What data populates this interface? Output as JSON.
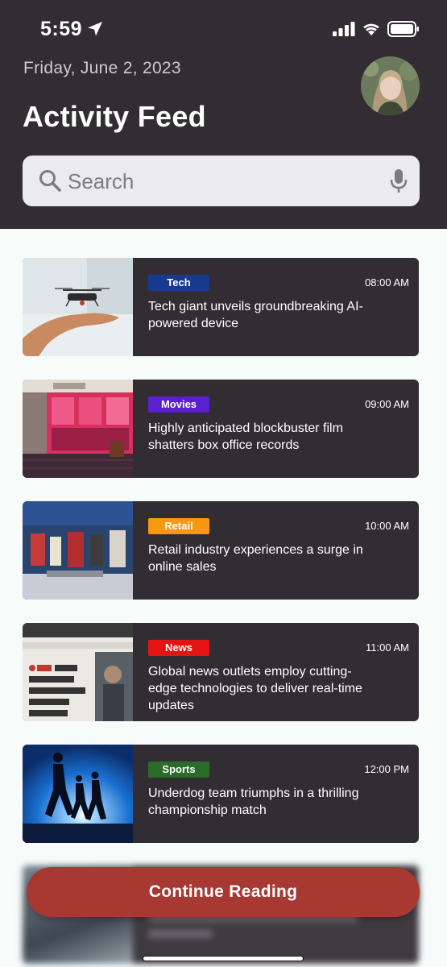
{
  "status_bar": {
    "time": "5:59",
    "icons": [
      "location-arrow-icon",
      "cellular-signal-icon",
      "wifi-icon",
      "battery-icon"
    ]
  },
  "header": {
    "date": "Friday, June 2, 2023",
    "title": "Activity Feed",
    "avatar": "profile-avatar"
  },
  "search": {
    "placeholder": "Search",
    "icon": "search-icon",
    "mic_icon": "microphone-icon"
  },
  "feed": [
    {
      "category": "Tech",
      "badge_color": "#173a8e",
      "time": "08:00 AM",
      "title": "Tech giant unveils groundbreaking AI-powered device",
      "thumb": "drone-hand-image"
    },
    {
      "category": "Movies",
      "badge_color": "#5a1fd0",
      "time": "09:00 AM",
      "title": "Highly anticipated blockbuster film shatters box office records",
      "thumb": "cinema-storefront-image"
    },
    {
      "category": "Retail",
      "badge_color": "#f59a10",
      "time": "10:00 AM",
      "title": "Retail industry experiences a surge in online sales",
      "thumb": "retail-store-image"
    },
    {
      "category": "News",
      "badge_color": "#e21414",
      "time": "11:00 AM",
      "title": "Global news outlets employ cutting-edge technologies to deliver real-time updates",
      "thumb": "news-website-image"
    },
    {
      "category": "Sports",
      "badge_color": "#2c6c2a",
      "time": "12:00 PM",
      "title": "Underdog team triumphs in a thrilling championship match",
      "thumb": "runners-silhouette-image"
    }
  ],
  "footer": {
    "continue_label": "Continue Reading",
    "button_color": "#a83832"
  }
}
